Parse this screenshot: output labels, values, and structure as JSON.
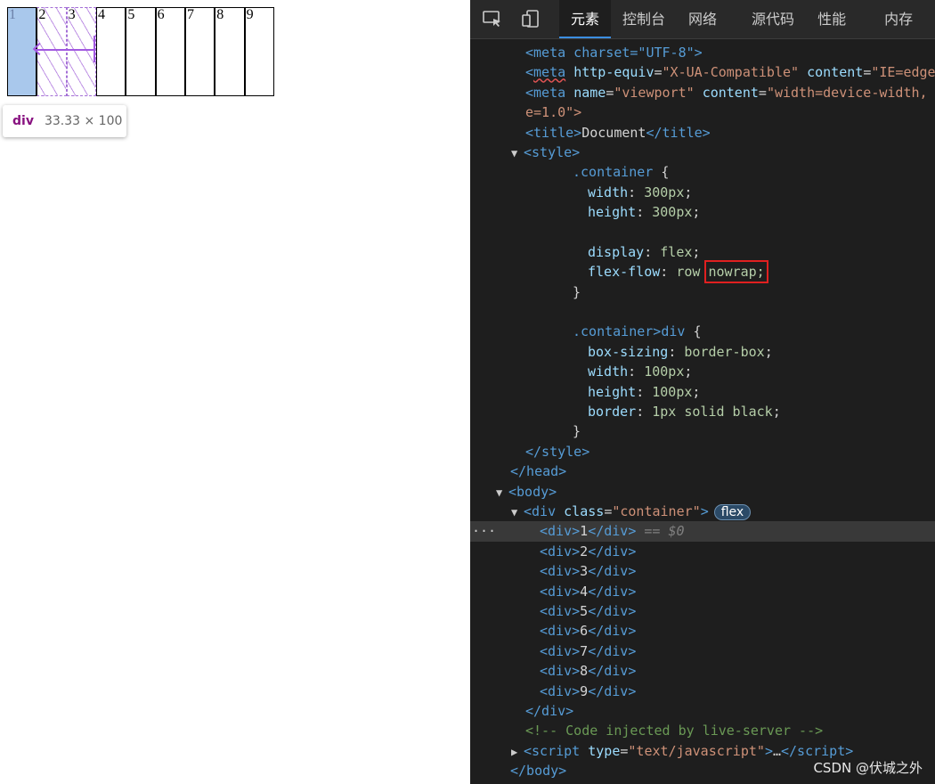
{
  "preview": {
    "cells": [
      "1",
      "2",
      "3",
      "4",
      "5",
      "6",
      "7",
      "8",
      "9"
    ],
    "tooltip": {
      "tag": "div",
      "dims": "33.33 × 100"
    }
  },
  "devtools": {
    "tabs": [
      "元素",
      "控制台",
      "网络",
      "源代码",
      "性能",
      "内存"
    ],
    "active_tab": "元素",
    "code": {
      "meta1": "<meta charset=\"UTF-8\">",
      "meta2_attr1": "http-equiv",
      "meta2_val1": "\"X-UA-Compatible\"",
      "meta2_attr2": "content",
      "meta2_val2": "\"IE=edge",
      "meta3_attr1": "name",
      "meta3_val1": "\"viewport\"",
      "meta3_attr2": "content",
      "meta3_val2": "\"width=device-width,",
      "meta3_cont": "e=1.0\">",
      "title_text": "Document",
      "sel_container": ".container",
      "width_prop": "width",
      "width_val": "300px",
      "height_prop": "height",
      "height_val": "300px",
      "display_prop": "display",
      "display_val": "flex",
      "flow_prop": "flex-flow",
      "flow_val1": "row",
      "flow_val2": "nowrap;",
      "sel_child": ".container>div",
      "bs_prop": "box-sizing",
      "bs_val": "border-box",
      "w2_prop": "width",
      "w2_val": "100px",
      "h2_prop": "height",
      "h2_val": "100px",
      "border_prop": "border",
      "border_val": "1px solid black",
      "div_class": "\"container\"",
      "flex_badge": "flex",
      "selected_hint": "== $0",
      "comment": "<!-- Code injected by live-server -->",
      "script_type": "\"text/javascript\"",
      "div_items": [
        "1",
        "2",
        "3",
        "4",
        "5",
        "6",
        "7",
        "8",
        "9"
      ]
    },
    "watermark": "CSDN @伏城之外"
  }
}
